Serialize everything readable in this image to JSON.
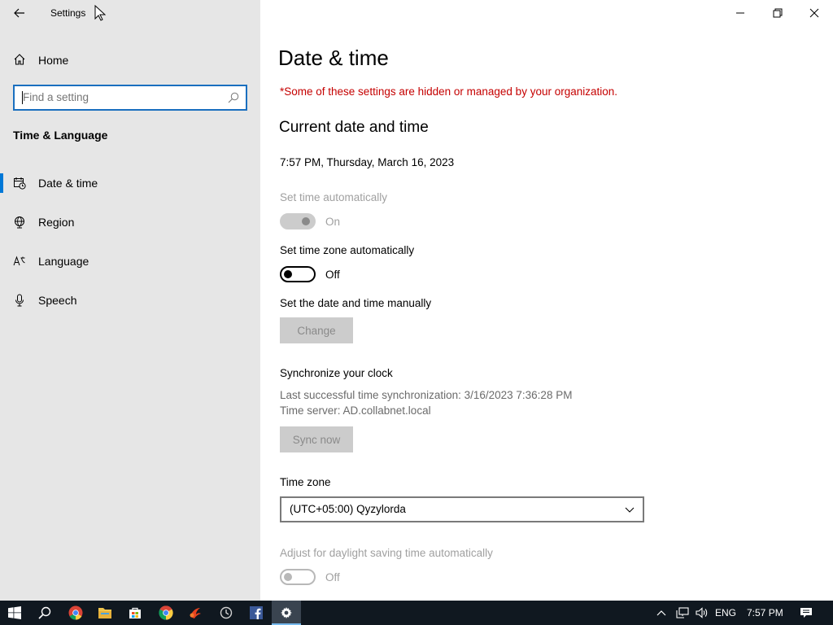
{
  "window": {
    "title": "Settings"
  },
  "sidebar": {
    "home_label": "Home",
    "search_placeholder": "Find a setting",
    "section_title": "Time & Language",
    "items": [
      {
        "label": "Date & time",
        "icon": "date-time-icon",
        "selected": true
      },
      {
        "label": "Region",
        "icon": "globe-icon",
        "selected": false
      },
      {
        "label": "Language",
        "icon": "language-icon",
        "selected": false
      },
      {
        "label": "Speech",
        "icon": "microphone-icon",
        "selected": false
      }
    ]
  },
  "main": {
    "page_title": "Date & time",
    "org_notice": "*Some of these settings are hidden or managed by your organization.",
    "current_section": "Current date and time",
    "current_datetime": "7:57 PM, Thursday, March 16, 2023",
    "set_time_auto": {
      "label": "Set time automatically",
      "state": "On",
      "disabled": true
    },
    "set_tz_auto": {
      "label": "Set time zone automatically",
      "state": "Off",
      "disabled": false
    },
    "manual": {
      "label": "Set the date and time manually",
      "button": "Change"
    },
    "sync": {
      "title": "Synchronize your clock",
      "last_sync": "Last successful time synchronization: 3/16/2023 7:36:28 PM",
      "server": "Time server: AD.collabnet.local",
      "button": "Sync now"
    },
    "timezone": {
      "label": "Time zone",
      "value": "(UTC+05:00) Qyzylorda"
    },
    "dst": {
      "label": "Adjust for daylight saving time automatically",
      "state": "Off",
      "disabled": true
    }
  },
  "taskbar": {
    "language": "ENG",
    "clock": "7:57 PM"
  },
  "colors": {
    "accent": "#0078d7",
    "sidebar_bg": "#e6e6e6",
    "notice_red": "#c50000",
    "taskbar_bg": "#101820"
  }
}
